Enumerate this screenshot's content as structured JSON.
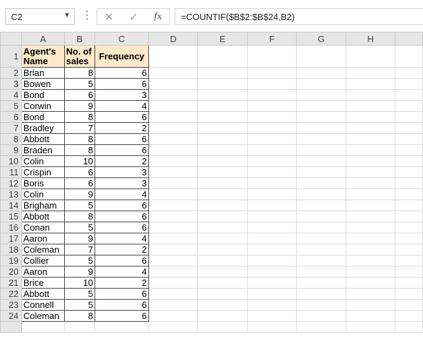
{
  "formula_bar": {
    "name_box": "C2",
    "formula": "=COUNTIF($B$2:$B$24,B2)"
  },
  "columns": [
    "A",
    "B",
    "C",
    "D",
    "E",
    "F",
    "G",
    "H"
  ],
  "header_row": {
    "a_line1": "Agent's",
    "a_line2": "Name",
    "b_line1": "No. of",
    "b_line2": "sales",
    "c": "Frequency"
  },
  "rows": [
    {
      "num": "2",
      "name": "Brian",
      "sales": "8",
      "freq": "6"
    },
    {
      "num": "3",
      "name": "Bowen",
      "sales": "5",
      "freq": "6"
    },
    {
      "num": "4",
      "name": "Bond",
      "sales": "6",
      "freq": "3"
    },
    {
      "num": "5",
      "name": "Corwin",
      "sales": "9",
      "freq": "4"
    },
    {
      "num": "6",
      "name": "Bond",
      "sales": "8",
      "freq": "6"
    },
    {
      "num": "7",
      "name": "Bradley",
      "sales": "7",
      "freq": "2"
    },
    {
      "num": "8",
      "name": "Abbott",
      "sales": "8",
      "freq": "6"
    },
    {
      "num": "9",
      "name": "Braden",
      "sales": "8",
      "freq": "6"
    },
    {
      "num": "10",
      "name": "Colin",
      "sales": "10",
      "freq": "2"
    },
    {
      "num": "11",
      "name": "Crispin",
      "sales": "6",
      "freq": "3"
    },
    {
      "num": "12",
      "name": "Boris",
      "sales": "6",
      "freq": "3"
    },
    {
      "num": "13",
      "name": "Colin",
      "sales": "9",
      "freq": "4"
    },
    {
      "num": "14",
      "name": "Brigham",
      "sales": "5",
      "freq": "6"
    },
    {
      "num": "15",
      "name": "Abbott",
      "sales": "8",
      "freq": "6"
    },
    {
      "num": "16",
      "name": "Conan",
      "sales": "5",
      "freq": "6"
    },
    {
      "num": "17",
      "name": "Aaron",
      "sales": "9",
      "freq": "4"
    },
    {
      "num": "18",
      "name": "Coleman",
      "sales": "7",
      "freq": "2"
    },
    {
      "num": "19",
      "name": "Collier",
      "sales": "5",
      "freq": "6"
    },
    {
      "num": "20",
      "name": "Aaron",
      "sales": "9",
      "freq": "4"
    },
    {
      "num": "21",
      "name": "Brice",
      "sales": "10",
      "freq": "2"
    },
    {
      "num": "22",
      "name": "Abbott",
      "sales": "5",
      "freq": "6"
    },
    {
      "num": "23",
      "name": "Connell",
      "sales": "5",
      "freq": "6"
    },
    {
      "num": "24",
      "name": "Coleman",
      "sales": "8",
      "freq": "6"
    }
  ],
  "first_row_number": "1"
}
